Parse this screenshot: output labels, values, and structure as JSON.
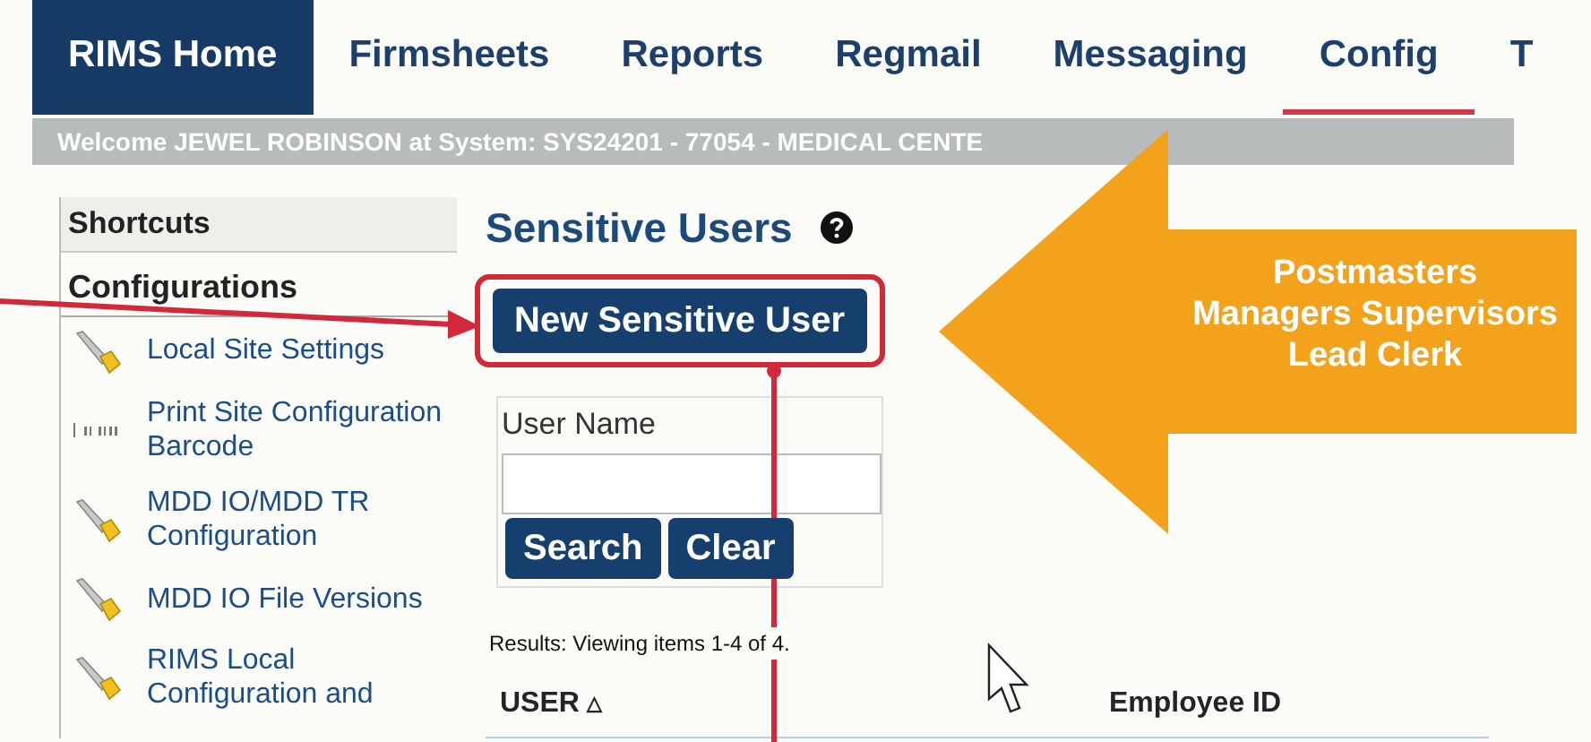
{
  "tabs": [
    {
      "label": "RIMS Home",
      "kind": "home",
      "selected": false
    },
    {
      "label": "Firmsheets",
      "kind": "tab",
      "selected": false
    },
    {
      "label": "Reports",
      "kind": "tab",
      "selected": false
    },
    {
      "label": "Regmail",
      "kind": "tab",
      "selected": false
    },
    {
      "label": "Messaging",
      "kind": "tab",
      "selected": false
    },
    {
      "label": "Config",
      "kind": "tab",
      "selected": true
    },
    {
      "label": "T",
      "kind": "tab",
      "selected": false
    }
  ],
  "welcome_bar": "Welcome JEWEL ROBINSON at System: SYS24201 - 77054 - MEDICAL CENTE",
  "sidebar": {
    "sections": [
      {
        "title": "Shortcuts",
        "expanded": false
      },
      {
        "title": "Configurations",
        "expanded": true,
        "items": [
          {
            "label": "Local Site Settings",
            "kind": "wrench"
          },
          {
            "label": "Print Site Configuration Barcode",
            "kind": "barcode"
          },
          {
            "label": "MDD IO/MDD TR Configuration",
            "kind": "wrench"
          },
          {
            "label": "MDD IO File Versions",
            "kind": "wrench"
          },
          {
            "label": "RIMS Local Configuration and",
            "kind": "wrench"
          }
        ]
      }
    ]
  },
  "page": {
    "title": "Sensitive Users",
    "new_button": "New Sensitive User",
    "search_form": {
      "label": "User Name",
      "buttons": [
        "Search",
        "Clear"
      ]
    },
    "results": "Results: Viewing items 1-4 of 4.",
    "table": {
      "columns": [
        {
          "label": "USER",
          "sort_mark": "△"
        },
        {
          "label": "Employee ID"
        }
      ]
    }
  },
  "annotation": {
    "callout": "Postmasters Managers Supervisors Lead Clerk"
  }
}
